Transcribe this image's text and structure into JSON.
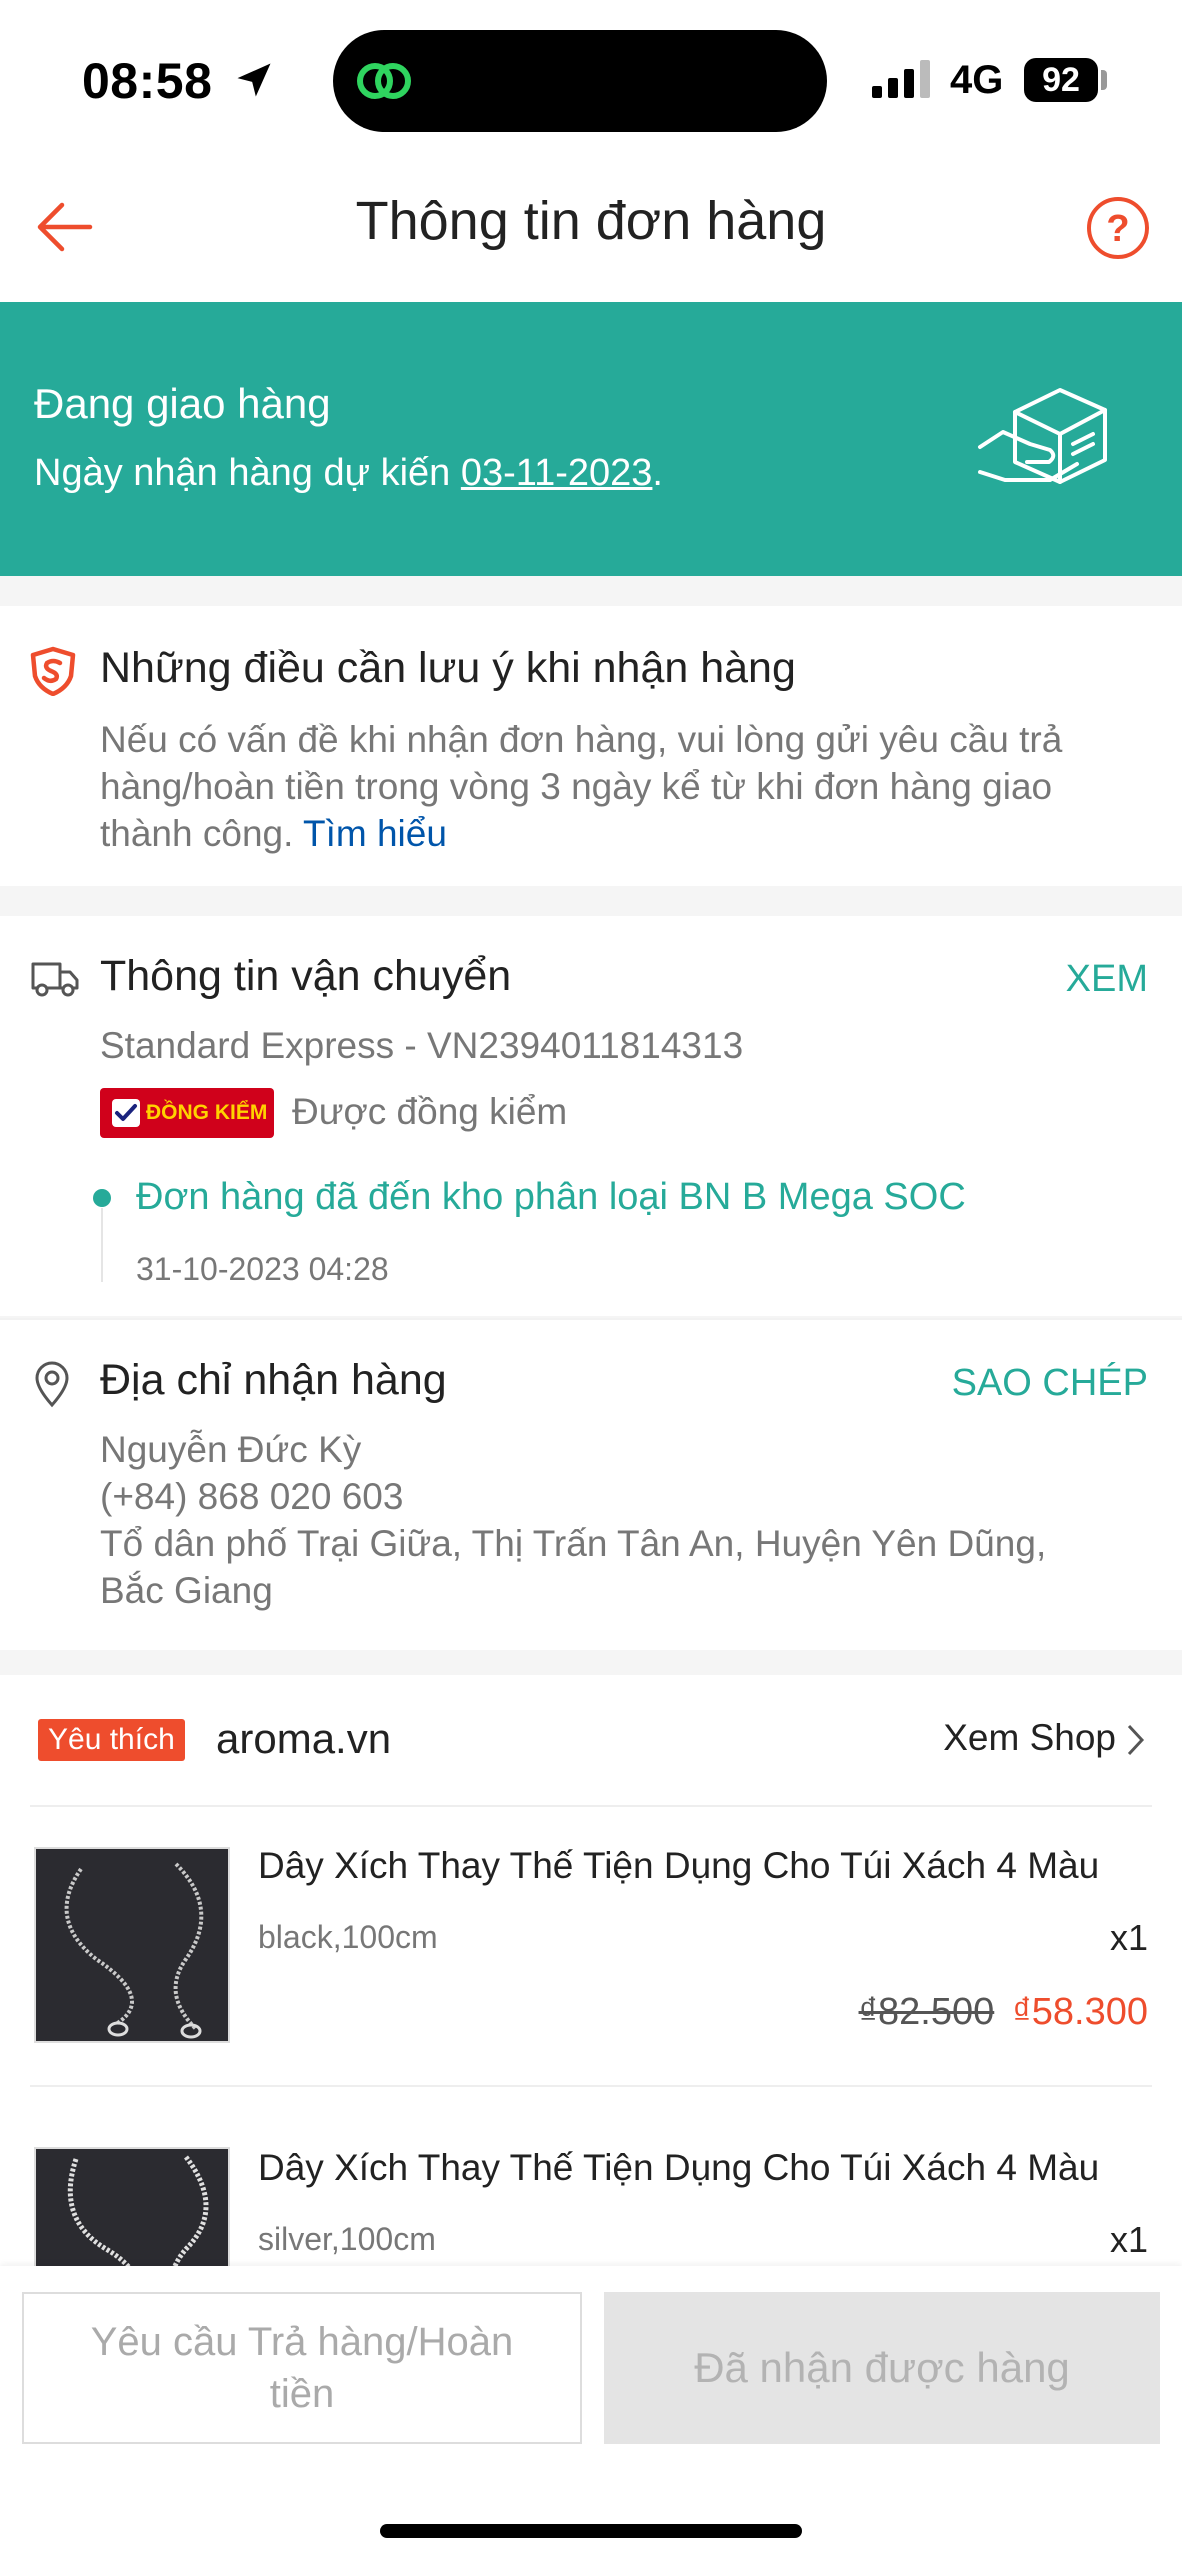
{
  "status_bar": {
    "time": "08:58",
    "network": "4G",
    "battery": "92"
  },
  "header": {
    "title": "Thông tin đơn hàng"
  },
  "banner": {
    "status": "Đang giao hàng",
    "eta_prefix": "Ngày nhận hàng dự kiến ",
    "eta_date": "03-11-2023",
    "eta_suffix": "."
  },
  "notice": {
    "title": "Những điều cần lưu ý khi nhận hàng",
    "text": "Nếu có vấn đề khi nhận đơn hàng, vui lòng gửi yêu cầu trả hàng/hoàn tiền trong vòng 3 ngày kể từ khi đơn hàng giao thành công. ",
    "link": "Tìm hiểu"
  },
  "shipping": {
    "title": "Thông tin vận chuyển",
    "action": "XEM",
    "carrier": "Standard Express - VN2394011814313",
    "badge": "ĐỒNG KIỂM",
    "badge_text": "Được đồng kiểm",
    "latest_event": "Đơn hàng đã đến kho phân loại BN B Mega SOC",
    "latest_time": "31-10-2023 04:28"
  },
  "address": {
    "title": "Địa chỉ nhận hàng",
    "action": "SAO CHÉP",
    "name": "Nguyễn Đức Kỳ",
    "phone": "(+84) 868 020 603",
    "line1": "Tổ dân phố Trại Giữa, Thị Trấn Tân An, Huyện Yên Dũng,",
    "line2": "Bắc Giang"
  },
  "shop": {
    "badge": "Yêu thích",
    "name": "aroma.vn",
    "view_label": "Xem Shop"
  },
  "products": [
    {
      "name": "Dây Xích Thay Thế Tiện Dụng Cho Túi Xách 4 Màu",
      "variant": "black,100cm",
      "qty": "x1",
      "old_price": "₫82.500",
      "price": "₫58.300"
    },
    {
      "name": "Dây Xích Thay Thế Tiện Dụng Cho Túi Xách 4 Màu",
      "variant": "silver,100cm",
      "qty": "x1"
    }
  ],
  "bottom_bar": {
    "return_label_line1": "Yêu cầu Trả hàng/Hoàn",
    "return_label_line2": "tiền",
    "received_label": "Đã nhận được hàng"
  },
  "colors": {
    "brand_orange": "#ee4d2d",
    "teal": "#26aa99",
    "link_blue": "#0055aa"
  },
  "icons": {
    "back": "arrow-left-icon",
    "help": "question-circle-icon",
    "banner": "package-delivery-icon",
    "notice": "shield-icon",
    "shipping": "truck-icon",
    "address": "location-pin-icon",
    "view_shop": "chevron-right-icon"
  }
}
